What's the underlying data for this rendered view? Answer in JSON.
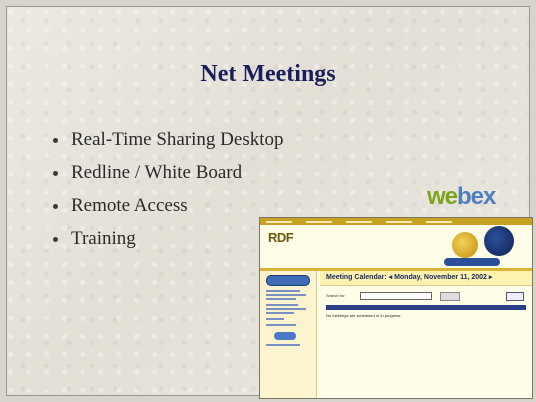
{
  "slide": {
    "title": "Net Meetings",
    "bullets": [
      "Real-Time Sharing Desktop",
      "Redline / White Board",
      "Remote Access",
      "Training"
    ],
    "logo": {
      "part1": "we",
      "part2": "bex"
    }
  },
  "screenshot": {
    "brand": "RDF",
    "calendar_title": "Meeting Calendar:  ◂ Monday, November 11, 2002 ▸",
    "search_label": "Search for:",
    "no_meetings_msg": "No meetings are scheduled or in progress.",
    "nav": [
      "Attend a Meeting",
      "Host a Meeting",
      "Set Up",
      "Assistance",
      "Privacy Policy"
    ]
  }
}
